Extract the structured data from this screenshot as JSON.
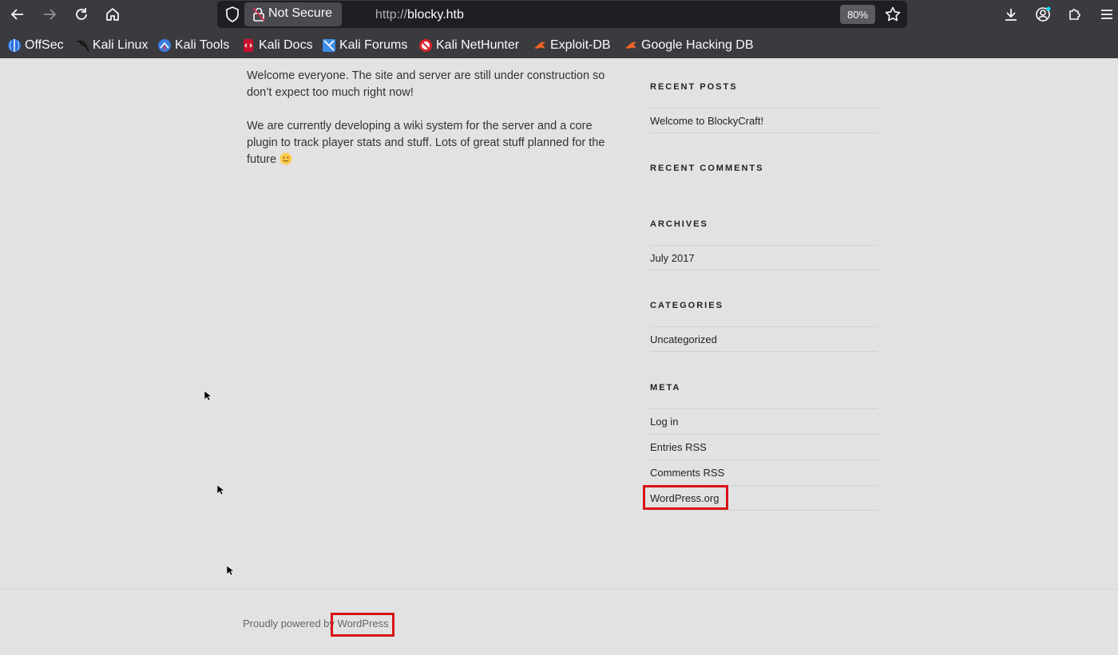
{
  "browser": {
    "security_label": "Not Secure",
    "url_protocol": "http://",
    "url_host": "blocky.htb",
    "zoom": "80%",
    "bookmarks": [
      {
        "label": "OffSec",
        "icon": "offsec-icon"
      },
      {
        "label": "Kali Linux",
        "icon": "kali-dragon-icon"
      },
      {
        "label": "Kali Tools",
        "icon": "kali-tools-icon"
      },
      {
        "label": "Kali Docs",
        "icon": "kali-docs-icon"
      },
      {
        "label": "Kali Forums",
        "icon": "kali-forums-icon"
      },
      {
        "label": "Kali NetHunter",
        "icon": "nethunter-icon"
      },
      {
        "label": "Exploit-DB",
        "icon": "exploit-db-icon"
      },
      {
        "label": "Google Hacking DB",
        "icon": "ghdb-icon"
      }
    ]
  },
  "post": {
    "paragraph1": "Welcome everyone. The site and server are still under construction so don’t expect too much right now!",
    "paragraph2": "We are currently developing a wiki system for the server and a core plugin to track player stats and stuff. Lots of great stuff planned for the future"
  },
  "sidebar": {
    "recent_posts": {
      "title": "RECENT POSTS",
      "items": [
        "Welcome to BlockyCraft!"
      ]
    },
    "recent_comments": {
      "title": "RECENT COMMENTS"
    },
    "archives": {
      "title": "ARCHIVES",
      "items": [
        "July 2017"
      ]
    },
    "categories": {
      "title": "CATEGORIES",
      "items": [
        "Uncategorized"
      ]
    },
    "meta": {
      "title": "META",
      "items": [
        "Log in",
        "Entries RSS",
        "Comments RSS",
        "WordPress.org"
      ]
    }
  },
  "footer": {
    "prefix": "Proudly powered by ",
    "link": "WordPress"
  },
  "colors": {
    "chrome_bg": "#3b3b3f",
    "urlbar_bg": "#1f1e25",
    "page_bg": "#e2e2e2",
    "highlight": "#d91216"
  }
}
